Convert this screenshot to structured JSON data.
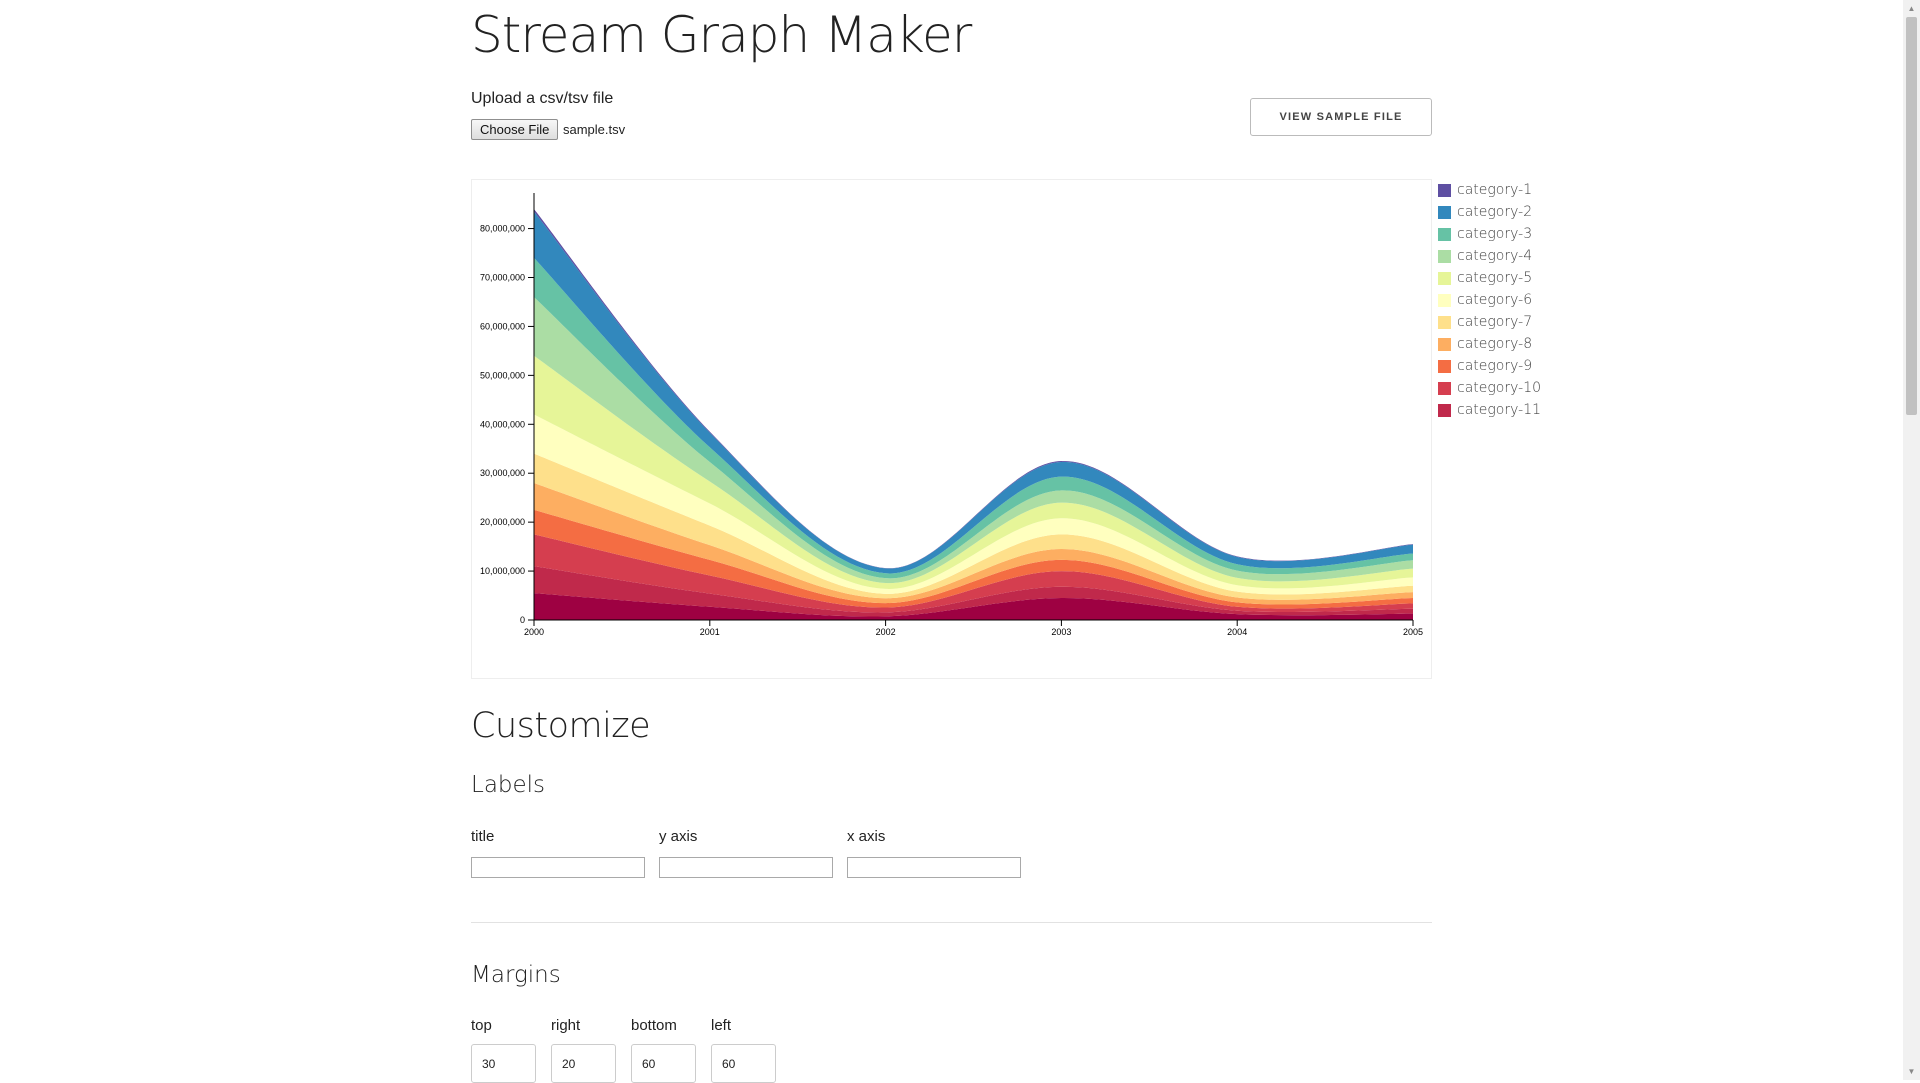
{
  "page": {
    "title": "Stream Graph Maker",
    "upload_label": "Upload a csv/tsv file",
    "choose_file_label": "Choose File",
    "file_name": "sample.tsv",
    "view_sample_label": "VIEW SAMPLE FILE"
  },
  "customize": {
    "heading": "Customize",
    "labels": {
      "heading": "Labels",
      "title_label": "title",
      "title_value": "",
      "y_axis_label": "y axis",
      "y_axis_value": "",
      "x_axis_label": "x axis",
      "x_axis_value": ""
    },
    "margins": {
      "heading": "Margins",
      "top_label": "top",
      "top_value": "30",
      "right_label": "right",
      "right_value": "20",
      "bottom_label": "bottom",
      "bottom_value": "60",
      "left_label": "left",
      "left_value": "60"
    }
  },
  "chart_data": {
    "type": "area",
    "stacked": true,
    "curve": "smooth",
    "x": [
      2000,
      2001,
      2002,
      2003,
      2004,
      2005
    ],
    "x_ticks": [
      "2000",
      "2001",
      "2002",
      "2003",
      "2004",
      "2005"
    ],
    "y_ticks": [
      "0",
      "10,000,000",
      "20,000,000",
      "30,000,000",
      "40,000,000",
      "50,000,000",
      "60,000,000",
      "70,000,000",
      "80,000,000"
    ],
    "ylim": [
      0,
      84000000
    ],
    "grid": false,
    "legend_position": "right",
    "series": [
      {
        "name": "category-1",
        "color": "#5e4fa2",
        "values": [
          500000,
          200000,
          50000,
          200000,
          100000,
          100000
        ]
      },
      {
        "name": "category-2",
        "color": "#3288bd",
        "values": [
          9500000,
          3000000,
          1000000,
          3000000,
          1500000,
          1800000
        ]
      },
      {
        "name": "category-3",
        "color": "#66c2a5",
        "values": [
          8000000,
          3000000,
          1000000,
          2800000,
          1300000,
          1400000
        ]
      },
      {
        "name": "category-4",
        "color": "#abdda4",
        "values": [
          12000000,
          4000000,
          1000000,
          2500000,
          1500000,
          1700000
        ]
      },
      {
        "name": "category-5",
        "color": "#e6f598",
        "values": [
          12000000,
          4500000,
          1200000,
          3200000,
          1500000,
          1800000
        ]
      },
      {
        "name": "category-6",
        "color": "#ffffbf",
        "values": [
          8000000,
          4500000,
          1000000,
          3300000,
          1300000,
          1700000
        ]
      },
      {
        "name": "category-7",
        "color": "#fee08b",
        "values": [
          6000000,
          4000000,
          900000,
          3000000,
          1200000,
          1300000
        ]
      },
      {
        "name": "category-8",
        "color": "#fdae61",
        "values": [
          5500000,
          3000000,
          1000000,
          2200000,
          1000000,
          1200000
        ]
      },
      {
        "name": "category-9",
        "color": "#f46d43",
        "values": [
          5000000,
          3200000,
          900000,
          2300000,
          900000,
          1100000
        ]
      },
      {
        "name": "category-10",
        "color": "#d53e4f",
        "values": [
          6500000,
          3700000,
          1000000,
          3200000,
          800000,
          1100000
        ]
      },
      {
        "name": "category-11",
        "color": "#c0294b",
        "values": [
          5500000,
          2700000,
          800000,
          2300000,
          700000,
          1000000
        ]
      },
      {
        "name": "",
        "color": "#9e0142",
        "values": [
          5500000,
          2700000,
          750000,
          4500000,
          1200000,
          1300000
        ]
      }
    ]
  }
}
